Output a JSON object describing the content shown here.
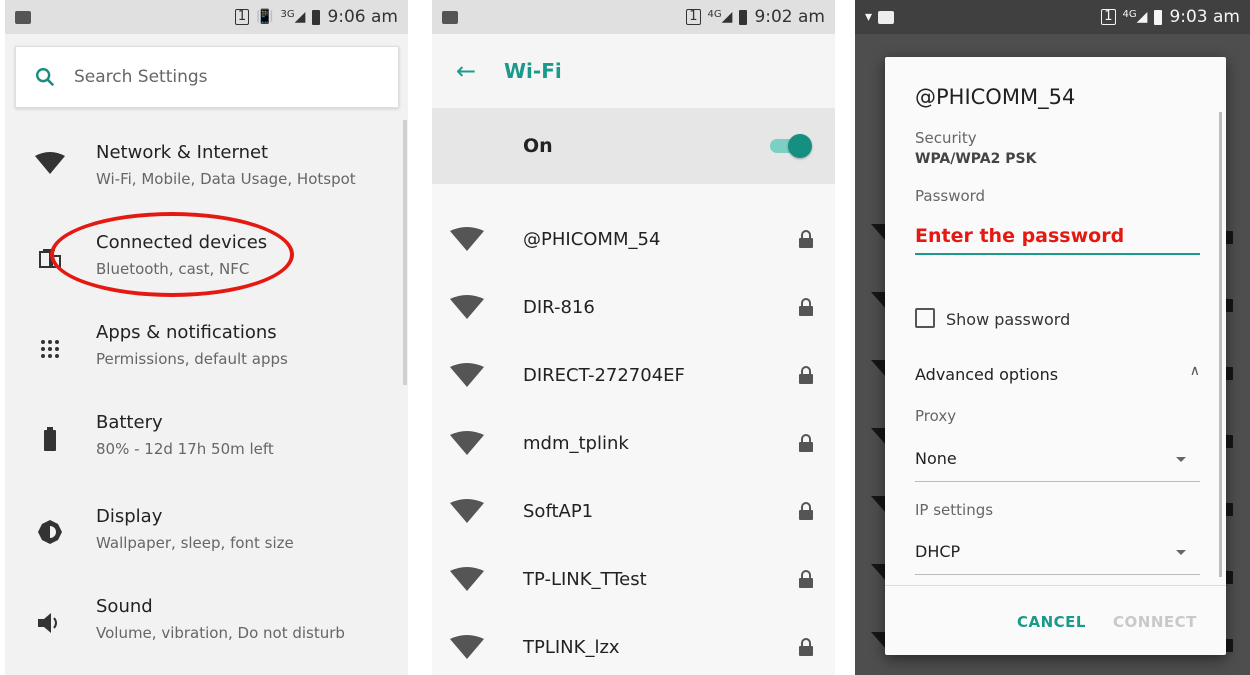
{
  "screen1": {
    "status": {
      "time": "9:06 am",
      "sim": "1",
      "network": "3G"
    },
    "search_placeholder": "Search Settings",
    "items": [
      {
        "title": "Network & Internet",
        "subtitle": "Wi-Fi, Mobile, Data Usage, Hotspot",
        "icon": "wifi-icon"
      },
      {
        "title": "Connected devices",
        "subtitle": "Bluetooth, cast, NFC",
        "icon": "devices-icon"
      },
      {
        "title": "Apps & notifications",
        "subtitle": "Permissions, default apps",
        "icon": "apps-grid-icon"
      },
      {
        "title": "Battery",
        "subtitle": "80% - 12d 17h 50m left",
        "icon": "battery-icon"
      },
      {
        "title": "Display",
        "subtitle": "Wallpaper, sleep, font size",
        "icon": "brightness-icon"
      },
      {
        "title": "Sound",
        "subtitle": "Volume, vibration, Do not disturb",
        "icon": "volume-icon"
      }
    ],
    "annotation_color": "#e41a12"
  },
  "screen2": {
    "status": {
      "time": "9:02 am",
      "sim": "1",
      "network": "4G"
    },
    "title": "Wi-Fi",
    "toggle_label": "On",
    "toggle_on": true,
    "accent": "#1a9a8a",
    "networks": [
      {
        "name": "@PHICOMM_54"
      },
      {
        "name": "DIR-816"
      },
      {
        "name": "DIRECT-272704EF"
      },
      {
        "name": "mdm_tplink"
      },
      {
        "name": "SoftAP1"
      },
      {
        "name": "TP-LINK_TTest"
      },
      {
        "name": "TPLINK_lzx"
      }
    ]
  },
  "screen3": {
    "status": {
      "time": "9:03 am",
      "sim": "1",
      "network": "4G"
    },
    "dialog": {
      "title": "@PHICOMM_54",
      "security_label": "Security",
      "security_value": "WPA/WPA2 PSK",
      "password_label": "Password",
      "password_value": "Enter the password",
      "show_password": "Show password",
      "show_password_checked": false,
      "advanced": "Advanced options",
      "proxy_label": "Proxy",
      "proxy_value": "None",
      "ip_label": "IP settings",
      "ip_value": "DHCP",
      "cancel": "CANCEL",
      "connect": "CONNECT"
    }
  }
}
